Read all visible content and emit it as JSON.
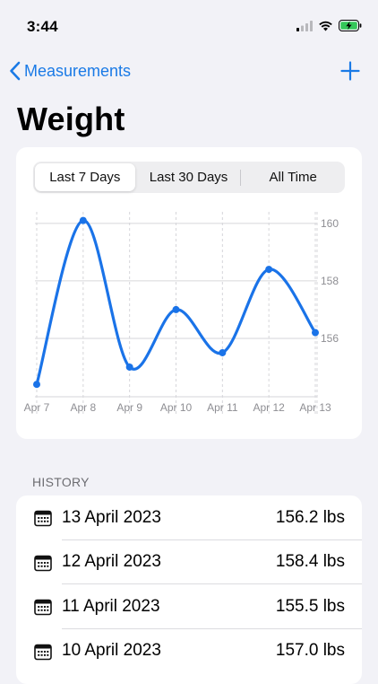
{
  "status_bar": {
    "time": "3:44"
  },
  "nav": {
    "back_label": "Measurements"
  },
  "page": {
    "title": "Weight"
  },
  "segments": [
    {
      "label": "Last 7 Days",
      "active": true
    },
    {
      "label": "Last 30 Days",
      "active": false
    },
    {
      "label": "All Time",
      "active": false
    }
  ],
  "chart_data": {
    "type": "line",
    "x": [
      "Apr 7",
      "Apr 8",
      "Apr 9",
      "Apr 10",
      "Apr 11",
      "Apr 12",
      "Apr 13"
    ],
    "series": [
      {
        "values": [
          154.4,
          160.1,
          155.0,
          157.0,
          155.5,
          158.4,
          156.2
        ]
      }
    ],
    "y_ticks": [
      160,
      158,
      156
    ],
    "ylim": [
      154.0,
      160.4
    ],
    "color": "#1a73e8",
    "grid": true,
    "y_axis_position": "right"
  },
  "history": {
    "header": "HISTORY",
    "rows": [
      {
        "date": "13 April 2023",
        "value": "156.2 lbs"
      },
      {
        "date": "12 April 2023",
        "value": "158.4 lbs"
      },
      {
        "date": "11 April 2023",
        "value": "155.5 lbs"
      },
      {
        "date": "10 April 2023",
        "value": "157.0 lbs"
      }
    ]
  }
}
